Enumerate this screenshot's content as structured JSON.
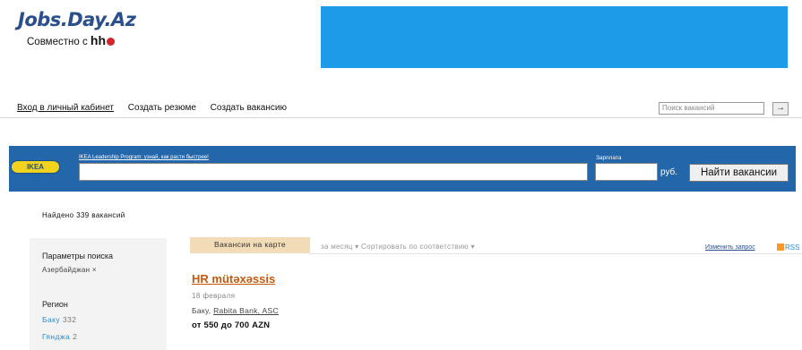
{
  "header": {
    "logo_text": "Jobs.Day.Az",
    "partner_prefix": "Совместно с",
    "partner_logo": "hh"
  },
  "nav": {
    "links": [
      "Вход в личный кабинет",
      "Создать резюме",
      "Создать вакансию"
    ],
    "search_placeholder": "Поиск вакансий",
    "search_button": "→"
  },
  "search": {
    "logo": "IKEA",
    "promo_text": "IKEA Leadership Program: узнай, как расти быстрее!",
    "salary_label": "Зарплата",
    "currency": "руб.",
    "button": "Найти вакансии"
  },
  "results": {
    "found": "Найдено 339 вакансий"
  },
  "sidebar": {
    "params_title": "Параметры поиска",
    "chip": "Азербайджан ×",
    "region_title": "Регион",
    "regions": [
      {
        "name": "Баку",
        "count": "332"
      },
      {
        "name": "Гянджа",
        "count": "2"
      }
    ]
  },
  "toolbar": {
    "map_tab": "Вакансии на карте",
    "period": "за месяц",
    "sort": "Сортировать по соответствию",
    "change_query": "Изменить запрос",
    "rss": "RSS"
  },
  "vacancy": {
    "title": "HR mütəxəssis",
    "date": "18 февраля",
    "city": "Баку,",
    "company": "Rabita Bank, ASC",
    "salary": "от 550 до 700 AZN"
  },
  "colors": {
    "logo": "#2b4f8c",
    "banner": "#1e9be8",
    "search_bar": "#2466aa",
    "vacancy_link": "#c35a0f",
    "region_link": "#2a8bd1"
  }
}
